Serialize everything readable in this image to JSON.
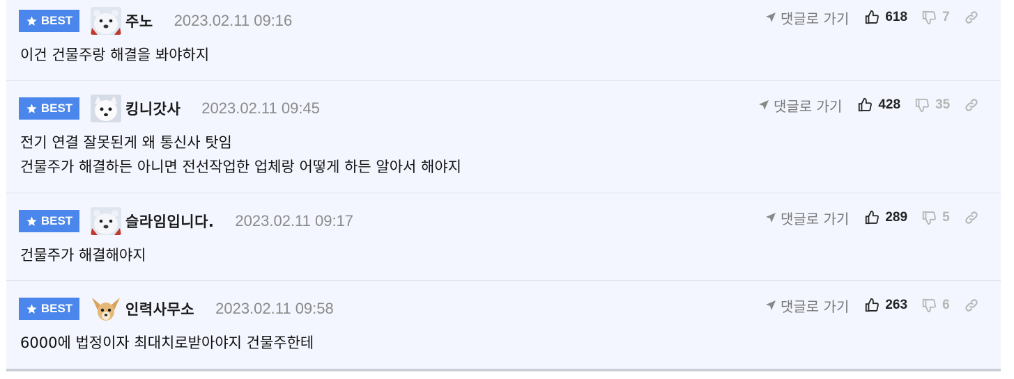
{
  "comments": [
    {
      "badge": "BEST",
      "nickname": "주노",
      "avatar_icon": "polar-bear-avatar-icon",
      "date": "2023.02.11 09:16",
      "reply_label": "댓글로 가기",
      "likes": "618",
      "dislikes": "7",
      "lines": [
        "이건 건물주랑 해결을 봐야하지"
      ]
    },
    {
      "badge": "BEST",
      "nickname": "킹니갓사",
      "avatar_icon": "white-dog-avatar-icon",
      "date": "2023.02.11 09:45",
      "reply_label": "댓글로 가기",
      "likes": "428",
      "dislikes": "35",
      "lines": [
        "전기 연결 잘못된게 왜 통신사 탓임",
        "건물주가 해결하든 아니면 전선작업한 업체랑 어떻게 하든 알아서 해야지"
      ]
    },
    {
      "badge": "BEST",
      "nickname": "슬라임입니다.",
      "avatar_icon": "polar-bear-avatar-icon",
      "date": "2023.02.11 09:17",
      "reply_label": "댓글로 가기",
      "likes": "289",
      "dislikes": "5",
      "lines": [
        "건물주가 해결해야지"
      ]
    },
    {
      "badge": "BEST",
      "nickname": "인력사무소",
      "avatar_icon": "chihuahua-avatar-icon",
      "date": "2023.02.11 09:58",
      "reply_label": "댓글로 가기",
      "likes": "263",
      "dislikes": "6",
      "lines": [
        "6000에 법정이자 최대치로받아야지 건물주한테"
      ]
    }
  ],
  "colors": {
    "best_badge": "#4a86ec",
    "row_background": "#f3f6fe",
    "date_text": "#8a8a8a",
    "dislike_text": "#b5b5b5"
  }
}
